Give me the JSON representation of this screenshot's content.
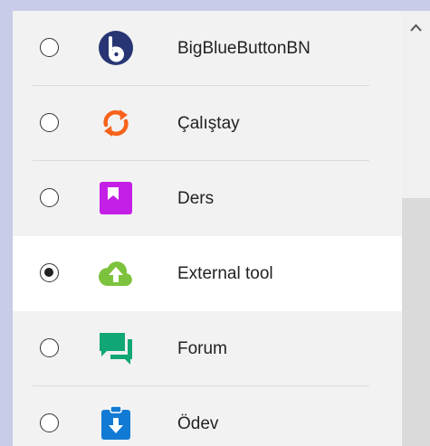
{
  "activities": [
    {
      "label": "BigBlueButtonBN",
      "icon": "bigbluebutton-icon",
      "selected": false
    },
    {
      "label": "Çalıştay",
      "icon": "workshop-arrows-icon",
      "selected": false
    },
    {
      "label": "Ders",
      "icon": "lesson-bookmark-icon",
      "selected": false
    },
    {
      "label": "External tool",
      "icon": "external-tool-upload-icon",
      "selected": true
    },
    {
      "label": "Forum",
      "icon": "forum-chat-icon",
      "selected": false
    },
    {
      "label": "Ödev",
      "icon": "assignment-download-icon",
      "selected": false
    }
  ],
  "colors": {
    "bigbluebutton": "#283574",
    "workshop": "#f7631b",
    "lesson": "#c31fe6",
    "external_tool": "#7dc23c",
    "forum": "#11a676",
    "assignment": "#117ad4"
  }
}
